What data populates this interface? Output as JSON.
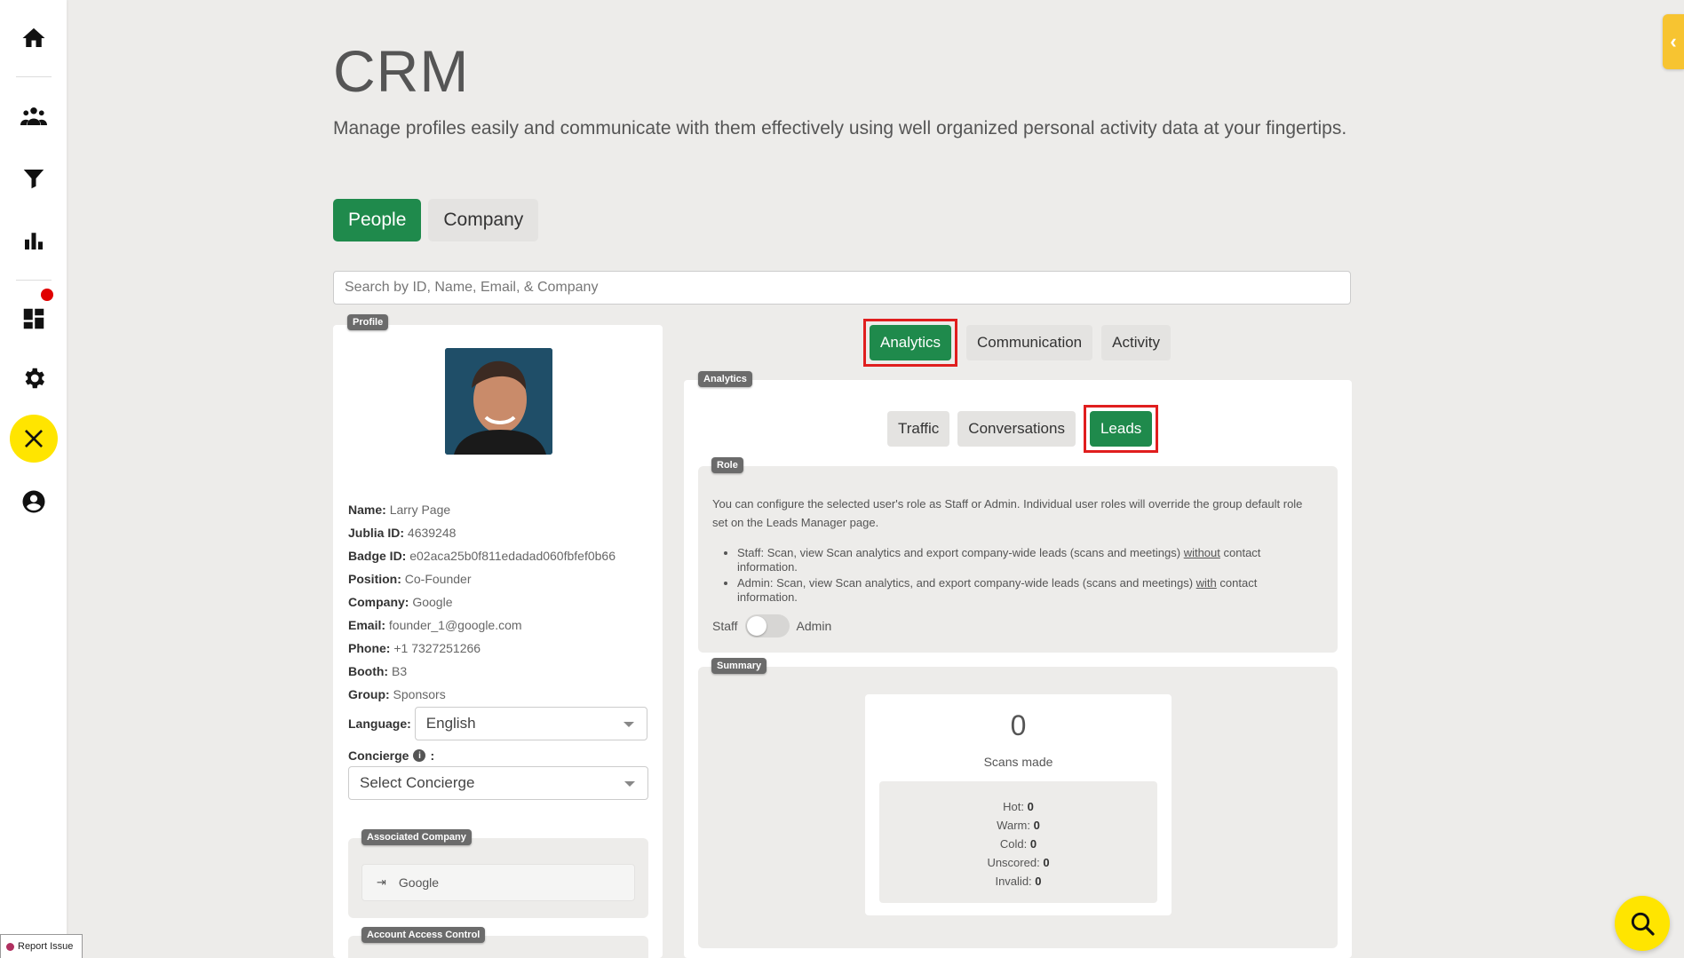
{
  "header": {
    "title": "CRM",
    "subtitle": "Manage profiles easily and communicate with them effectively using well organized personal activity data at your fingertips."
  },
  "sidebar": {
    "items": [
      {
        "icon": "home-icon"
      },
      {
        "icon": "people-icon"
      },
      {
        "icon": "filter-icon"
      },
      {
        "icon": "bar-chart-icon"
      },
      {
        "icon": "dashboard-icon"
      },
      {
        "icon": "gear-icon"
      },
      {
        "icon": "tools-icon"
      },
      {
        "icon": "account-icon"
      }
    ],
    "report_issue": "Report Issue"
  },
  "main_tabs": {
    "people": "People",
    "company": "Company"
  },
  "search": {
    "placeholder": "Search by ID, Name, Email, & Company"
  },
  "profile": {
    "badge": "Profile",
    "fields": [
      {
        "label": "Name:",
        "value": "Larry Page"
      },
      {
        "label": "Jublia ID:",
        "value": "4639248"
      },
      {
        "label": "Badge ID:",
        "value": "e02aca25b0f811edadad060fbfef0b66"
      },
      {
        "label": "Position:",
        "value": "Co-Founder"
      },
      {
        "label": "Company:",
        "value": "Google"
      },
      {
        "label": "Email:",
        "value": "founder_1@google.com"
      },
      {
        "label": "Phone:",
        "value": "+1 7327251266"
      },
      {
        "label": "Booth:",
        "value": "B3"
      },
      {
        "label": "Group:",
        "value": "Sponsors"
      }
    ],
    "language_label": "Language:",
    "language_value": "English",
    "concierge_label": "Concierge",
    "concierge_colon": ":",
    "concierge_placeholder": "Select Concierge",
    "associated_company_badge": "Associated Company",
    "associated_company": "Google",
    "access_control_badge": "Account Access Control"
  },
  "right_tabs": {
    "analytics": "Analytics",
    "communication": "Communication",
    "activity": "Activity"
  },
  "analytics": {
    "badge": "Analytics",
    "sub_tabs": {
      "traffic": "Traffic",
      "conversations": "Conversations",
      "leads": "Leads"
    },
    "role": {
      "badge": "Role",
      "description": "You can configure the selected user's role as Staff or Admin. Individual user roles will override the group default role set on the Leads Manager page.",
      "staff_item_a": "Staff: Scan, view Scan analytics and export company-wide leads (scans and meetings) ",
      "staff_item_u": "without",
      "staff_item_b": " contact information.",
      "admin_item_a": "Admin: Scan, view Scan analytics, and export company-wide leads (scans and meetings) ",
      "admin_item_u": "with",
      "admin_item_b": " contact information.",
      "toggle_left": "Staff",
      "toggle_right": "Admin"
    },
    "summary": {
      "badge": "Summary",
      "scans_count": "0",
      "scans_label": "Scans made",
      "hot_label": "Hot:",
      "hot": "0",
      "warm_label": "Warm:",
      "warm": "0",
      "cold_label": "Cold:",
      "cold": "0",
      "unscored_label": "Unscored:",
      "unscored": "0",
      "invalid_label": "Invalid:",
      "invalid": "0"
    }
  },
  "colors": {
    "primary_green": "#1f8a4c",
    "accent_yellow": "#ffe500",
    "highlight_red": "#e01e1e"
  }
}
